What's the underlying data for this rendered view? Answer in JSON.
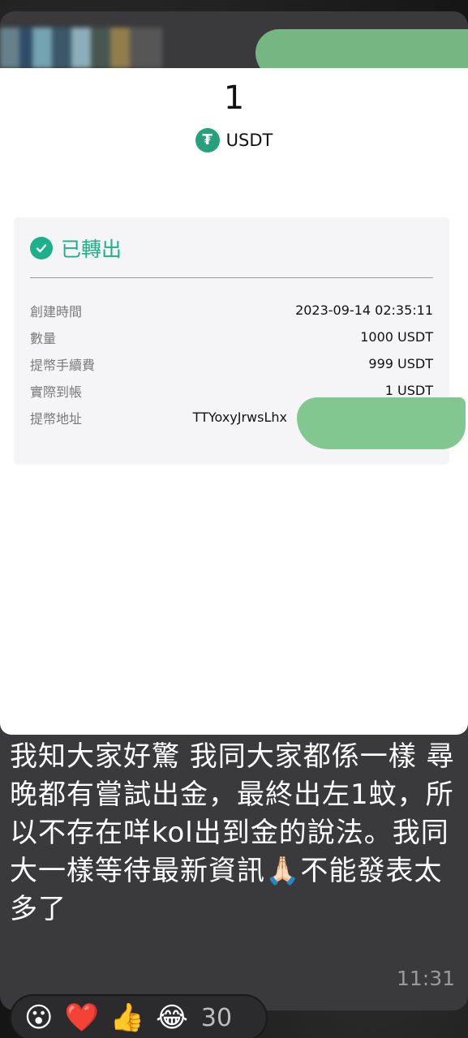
{
  "screenshot": {
    "amount": "1",
    "token": "USDT",
    "status": "已轉出",
    "details": [
      {
        "label": "創建時間",
        "value": "2023-09-14 02:35:11"
      },
      {
        "label": "數量",
        "value": "1000 USDT"
      },
      {
        "label": "提幣手續費",
        "value": "999 USDT"
      },
      {
        "label": "實際到帳",
        "value": "1 USDT"
      },
      {
        "label": "提幣地址",
        "value": "TTYoxyJrwsLhx"
      }
    ]
  },
  "message": {
    "text": "我知大家好驚 我同大家都係一樣 尋晚都有嘗試出金，最終出左1蚊，所以不存在咩kol出到金的說法。我同大一樣等待最新資訊🙏🏻不能發表太多了",
    "time": "11:31"
  },
  "reactions": {
    "emojis": [
      "😮",
      "❤️",
      "👍",
      "😂"
    ],
    "count": "30"
  },
  "colors": {
    "bubble": "#3a3a3c",
    "accent_green": "#1db08b",
    "tether": "#26a17b",
    "redaction": "#7cc48a"
  }
}
